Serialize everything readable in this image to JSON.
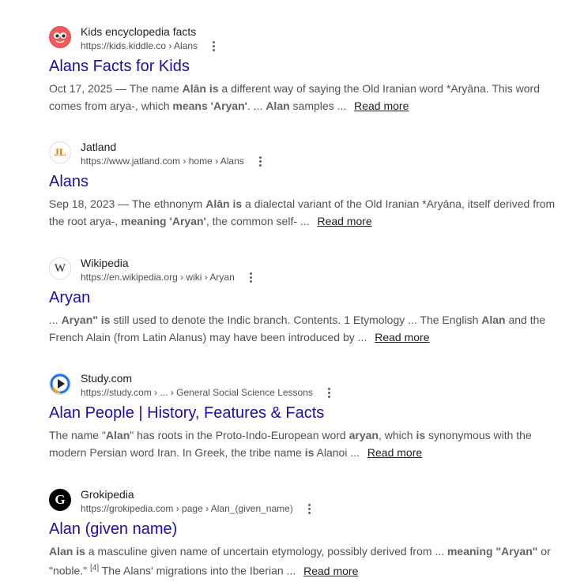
{
  "results": [
    {
      "site": "Kids encyclopedia facts",
      "url": "https://kids.kiddle.co › Alans",
      "favicon": "kiddle-face-icon",
      "title": "Alans Facts for Kids",
      "snippet": [
        {
          "t": "Oct 17, 2025 — The name ",
          "b": false
        },
        {
          "t": "Alān is",
          "b": true
        },
        {
          "t": " a different way of saying the Old Iranian word *Aryāna. This word comes from arya-, which ",
          "b": false
        },
        {
          "t": "means 'Aryan'",
          "b": true
        },
        {
          "t": ". ... ",
          "b": false
        },
        {
          "t": "Alan",
          "b": true
        },
        {
          "t": " samples ... ",
          "b": false
        }
      ],
      "read_more": "Read more"
    },
    {
      "site": "Jatland",
      "url": "https://www.jatland.com › home › Alans",
      "favicon": "jatland-jl-icon",
      "favicon_text": "JL",
      "title": "Alans",
      "snippet": [
        {
          "t": "Sep 18, 2023 — The ethnonym ",
          "b": false
        },
        {
          "t": "Alān is",
          "b": true
        },
        {
          "t": " a dialectal variant of the Old Iranian *Aryāna, itself derived from the root arya-, ",
          "b": false
        },
        {
          "t": "meaning 'Aryan'",
          "b": true
        },
        {
          "t": ", the common self- ... ",
          "b": false
        }
      ],
      "read_more": "Read more"
    },
    {
      "site": "Wikipedia",
      "url": "https://en.wikipedia.org › wiki › Aryan",
      "favicon": "wikipedia-w-icon",
      "favicon_text": "W",
      "title": "Aryan",
      "snippet": [
        {
          "t": "... ",
          "b": false
        },
        {
          "t": "Aryan\" is",
          "b": true
        },
        {
          "t": " still used to denote the Indic branch. Contents. 1 Etymology ... The English ",
          "b": false
        },
        {
          "t": "Alan",
          "b": true
        },
        {
          "t": " and the French Alain (from Latin Alanus) may have been introduced by ... ",
          "b": false
        }
      ],
      "read_more": "Read more"
    },
    {
      "site": "Study.com",
      "url": "https://study.com › ... › General Social Science Lessons",
      "favicon": "study-play-icon",
      "title": "Alan People | History, Features & Facts",
      "snippet": [
        {
          "t": "The name \"",
          "b": false
        },
        {
          "t": "Alan",
          "b": true
        },
        {
          "t": "\" has roots in the Proto-Indo-European word ",
          "b": false
        },
        {
          "t": "aryan",
          "b": true
        },
        {
          "t": ", which ",
          "b": false
        },
        {
          "t": "is",
          "b": true
        },
        {
          "t": " synonymous with the modern Persian word Iran. In Greek, the tribe name ",
          "b": false
        },
        {
          "t": "is",
          "b": true
        },
        {
          "t": " Alanoi ... ",
          "b": false
        }
      ],
      "read_more": "Read more"
    },
    {
      "site": "Grokipedia",
      "url": "https://grokipedia.com › page › Alan_(given_name)",
      "favicon": "grokipedia-g-icon",
      "favicon_text": "G",
      "title": "Alan (given name)",
      "snippet": [
        {
          "t": "Alan is",
          "b": true
        },
        {
          "t": " a masculine given name of uncertain etymology, possibly derived from ... ",
          "b": false
        },
        {
          "t": "meaning \"Aryan\"",
          "b": true
        },
        {
          "t": " or \"noble.\" ",
          "b": false
        },
        {
          "t": "[4]",
          "b": false,
          "sup": true
        },
        {
          "t": " The Alans' migrations into the Iberian ... ",
          "b": false
        }
      ],
      "read_more": "Read more"
    }
  ],
  "colors": {
    "title": "#1a0dab",
    "text": "#4d5156",
    "site": "#202124"
  }
}
